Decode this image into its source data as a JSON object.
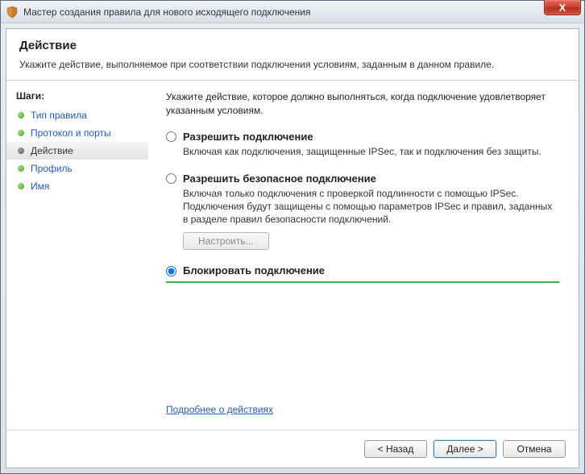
{
  "window": {
    "title": "Мастер создания правила для нового исходящего подключения",
    "close_glyph": "X"
  },
  "header": {
    "title": "Действие",
    "description": "Укажите действие, выполняемое при соответствии подключения условиям, заданным в данном правиле."
  },
  "sidebar": {
    "steps_label": "Шаги:",
    "items": [
      {
        "label": "Тип правила",
        "active": false
      },
      {
        "label": "Протокол и порты",
        "active": false
      },
      {
        "label": "Действие",
        "active": true
      },
      {
        "label": "Профиль",
        "active": false
      },
      {
        "label": "Имя",
        "active": false
      }
    ]
  },
  "main": {
    "instruction": "Укажите действие, которое должно выполняться, когда подключение удовлетворяет указанным условиям.",
    "options": [
      {
        "title": "Разрешить подключение",
        "description": "Включая как подключения, защищенные IPSec, так и подключения без защиты.",
        "selected": false
      },
      {
        "title": "Разрешить безопасное подключение",
        "description": "Включая только подключения с проверкой подлинности с помощью IPSec. Подключения будут защищены с помощью параметров IPSec и правил, заданных в разделе правил безопасности подключений.",
        "customize_label": "Настроить...",
        "selected": false
      },
      {
        "title": "Блокировать подключение",
        "selected": true
      }
    ],
    "learn_more": "Подробнее о действиях"
  },
  "footer": {
    "back": "< Назад",
    "next": "Далее >",
    "cancel": "Отмена"
  }
}
